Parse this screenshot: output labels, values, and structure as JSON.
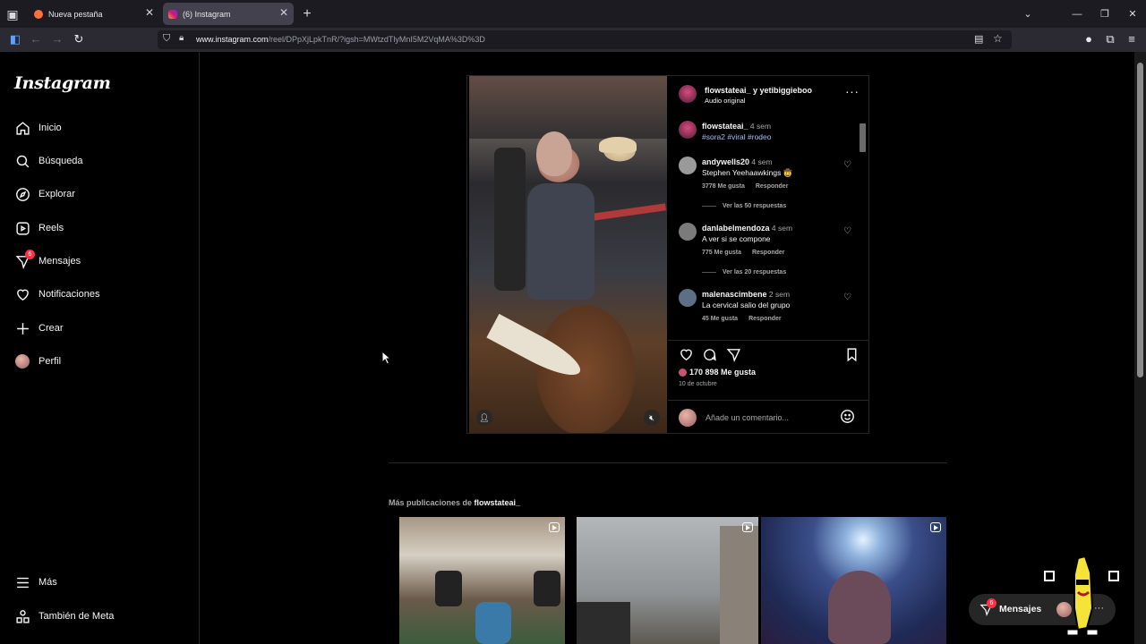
{
  "browser": {
    "tabs": [
      {
        "label": "Nueva pestaña",
        "active": false
      },
      {
        "label": "(6) Instagram",
        "active": true
      }
    ],
    "url_host": "www.instagram.com",
    "url_path": "/reel/DPpXjLpkTnR/?igsh=MWtzdTlyMnI5M2VqMA%3D%3D"
  },
  "sidebar": {
    "logo": "Instagram",
    "items": [
      {
        "label": "Inicio",
        "icon": "home-icon"
      },
      {
        "label": "Búsqueda",
        "icon": "search-icon"
      },
      {
        "label": "Explorar",
        "icon": "compass-icon"
      },
      {
        "label": "Reels",
        "icon": "reels-icon"
      },
      {
        "label": "Mensajes",
        "icon": "messenger-icon",
        "badge": "6"
      },
      {
        "label": "Notificaciones",
        "icon": "heart-icon"
      },
      {
        "label": "Crear",
        "icon": "plus-icon"
      },
      {
        "label": "Perfil",
        "icon": "avatar"
      }
    ],
    "bottom": [
      {
        "label": "Más",
        "icon": "menu-icon"
      },
      {
        "label": "También de Meta",
        "icon": "meta-icon"
      }
    ]
  },
  "post": {
    "authors": "flowstateai_ y yetibiggieboo",
    "audio": "Audio original",
    "caption": {
      "user": "flowstateai_",
      "time": "4 sem",
      "text": "#sora2 #viral #rodeo"
    },
    "comments": [
      {
        "user": "andywells20",
        "time": "4 sem",
        "text": "Stephen Yeehaawkings 🤠",
        "likes": "3778 Me gusta",
        "reply": "Responder",
        "replies": "Ver las 50 respuestas"
      },
      {
        "user": "danlabelmendoza",
        "time": "4 sem",
        "text": "A ver si se compone",
        "likes": "775 Me gusta",
        "reply": "Responder",
        "replies": "Ver las 20 respuestas"
      },
      {
        "user": "malenascimbene",
        "time": "2 sem",
        "text": "La cervical salio del grupo",
        "likes": "45 Me gusta",
        "reply": "Responder",
        "replies": ""
      }
    ],
    "likes": "170 898 Me gusta",
    "date": "10 de octubre",
    "comment_placeholder": "Añade un comentario..."
  },
  "more": {
    "prefix": "Más publicaciones de",
    "user": "flowstateai_"
  },
  "messages_pill": {
    "label": "Mensajes",
    "badge": "6"
  },
  "colors": {
    "background": "#000000",
    "text": "#f5f5f5",
    "secondary_text": "#a8a8a8",
    "hashtag": "#a9bfff",
    "badge": "#ff3040",
    "browser_tabbar": "#1c1b22",
    "browser_navbar": "#2b2a33"
  }
}
